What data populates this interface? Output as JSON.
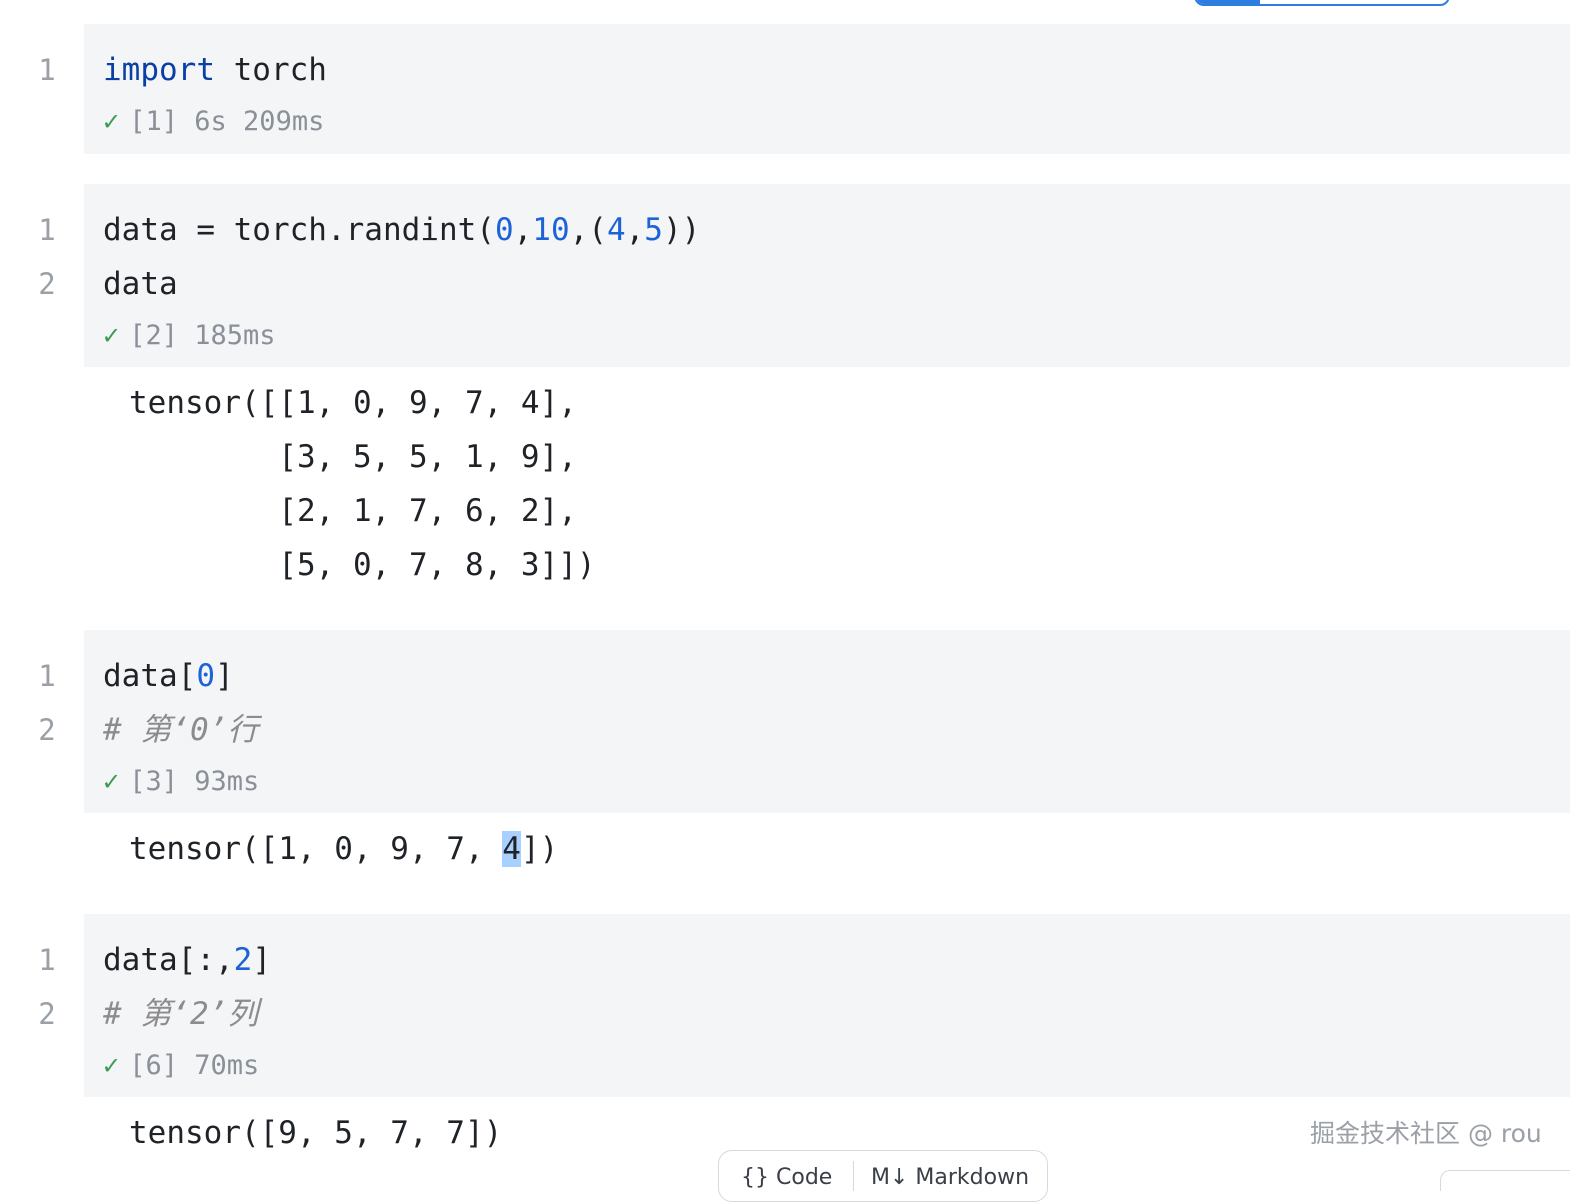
{
  "cells": [
    {
      "lines": [
        {
          "num": "1"
        }
      ],
      "code": {
        "l1_kw": "import",
        "l1_rest": " torch"
      },
      "status": {
        "check": "✓",
        "text": "[1] 6s 209ms"
      }
    },
    {
      "lines": [
        {
          "num": "1"
        },
        {
          "num": "2"
        }
      ],
      "code": {
        "l1_a": "data = torch.randint(",
        "l1_n1": "0",
        "l1_c1": ",",
        "l1_n2": "10",
        "l1_c2": ",(",
        "l1_n3": "4",
        "l1_c3": ",",
        "l1_n4": "5",
        "l1_end": "))",
        "l2": "data"
      },
      "status": {
        "check": "✓",
        "text": "[2] 185ms"
      },
      "output": [
        "tensor([[1, 0, 9, 7, 4],",
        "        [3, 5, 5, 1, 9],",
        "        [2, 1, 7, 6, 2],",
        "        [5, 0, 7, 8, 3]])"
      ]
    },
    {
      "lines": [
        {
          "num": "1"
        },
        {
          "num": "2"
        }
      ],
      "code": {
        "l1_a": "data[",
        "l1_n1": "0",
        "l1_end": "]",
        "l2_comment": "# 第‘0’行"
      },
      "status": {
        "check": "✓",
        "text": "[3] 93ms"
      },
      "output": {
        "before": "tensor([1, 0, 9, 7, ",
        "selected": "4",
        "after": "])"
      }
    },
    {
      "lines": [
        {
          "num": "1"
        },
        {
          "num": "2"
        }
      ],
      "code": {
        "l1_a": "data[:,",
        "l1_n1": "2",
        "l1_end": "]",
        "l2_comment": "# 第‘2’列"
      },
      "status": {
        "check": "✓",
        "text": "[6] 70ms"
      },
      "output": [
        "tensor([9, 5, 7, 7])"
      ]
    }
  ],
  "watermark": "掘金技术社区 @ rou",
  "bottom_toolbar": {
    "code_label": "Code",
    "markdown_label": "Markdown"
  },
  "colors": {
    "cell_bg": "#f4f5f7",
    "keyword": "#0a3fa6",
    "number": "#1c63d8",
    "check": "#3d9a4f",
    "selection": "#a8d1ff"
  }
}
